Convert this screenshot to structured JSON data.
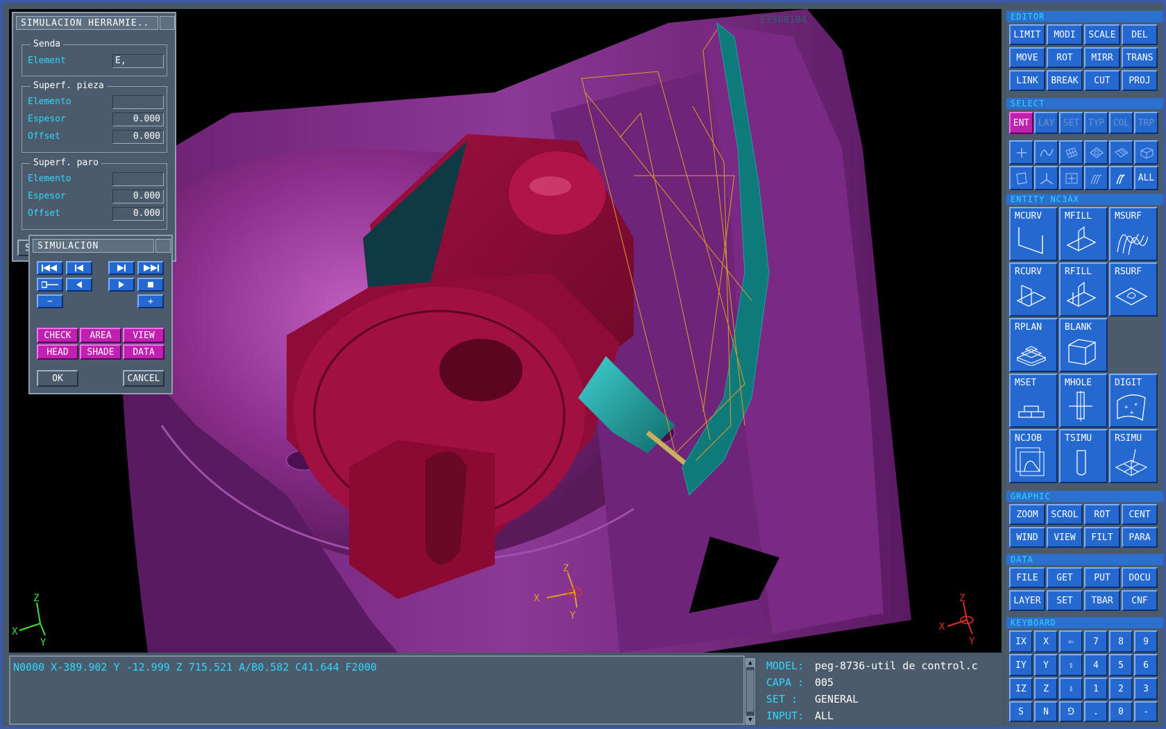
{
  "viewport": {
    "top_label": "E7360104",
    "axis_left": {
      "x": "X",
      "y": "Y",
      "z": "Z"
    },
    "axis_center": {
      "x": "X",
      "y": "Y",
      "z": "Z"
    },
    "axis_right": {
      "x": "X",
      "y": "Y",
      "z": "Z"
    }
  },
  "dialog_tool": {
    "title": "SIMULACION HERRAMIE..",
    "group_senda": {
      "title": "Senda",
      "element_label": "Element",
      "element_value": "E,"
    },
    "group_pieza": {
      "title": "Superf. pieza",
      "elemento_label": "Elemento",
      "elemento_value": "",
      "espesor_label": "Espesor",
      "espesor_value": "0.000",
      "offset_label": "Offset",
      "offset_value": "0.000"
    },
    "group_paro": {
      "title": "Superf. paro",
      "elemento_label": "Elemento",
      "elemento_value": "",
      "espesor_label": "Espesor",
      "espesor_value": "0.000",
      "offset_label": "Offset",
      "offset_value": "0.000"
    },
    "peek_label": "S"
  },
  "dialog_sim": {
    "title": "SIMULACION",
    "minus": "−",
    "plus": "+",
    "check": "CHECK",
    "area": "AREA",
    "view": "VIEW",
    "head": "HEAD",
    "shade": "SHADE",
    "data": "DATA",
    "ok": "OK",
    "cancel": "CANCEL"
  },
  "console": {
    "line": "N0000 X-389.902 Y -12.999 Z 715.521 A/B0.582 C41.644 F2000"
  },
  "info": {
    "model_key": "MODEL:",
    "model_val": "peg-8736-util de control.c",
    "capa_key": "CAPA :",
    "capa_val": "005",
    "set_key": "SET  :",
    "set_val": "GENERAL",
    "input_key": "INPUT:",
    "input_val": "ALL"
  },
  "panel": {
    "editor": {
      "title": "EDITOR",
      "buttons": [
        "LIMIT",
        "MODI",
        "SCALE",
        "DEL",
        "MOVE",
        "ROT",
        "MIRR",
        "TRANS",
        "LINK",
        "BREAK",
        "CUT",
        "PROJ"
      ]
    },
    "select": {
      "title": "SELECT",
      "buttons": [
        "ENT",
        "LAY",
        "SET",
        "TYP",
        "COL",
        "TRP"
      ],
      "all": "ALL"
    },
    "entity": {
      "title": "ENTITY  NC3AX",
      "buttons": [
        "MCURV",
        "MFILL",
        "MSURF",
        "RCURV",
        "RFILL",
        "RSURF",
        "RPLAN",
        "BLANK",
        "MSET",
        "MHOLE",
        "DIGIT",
        "NCJOB",
        "TSIMU",
        "RSIMU"
      ]
    },
    "graphic": {
      "title": "GRAPHIC",
      "buttons": [
        "ZOOM",
        "SCROL",
        "ROT",
        "CENT",
        "WIND",
        "VIEW",
        "FILT",
        "PARA"
      ]
    },
    "data": {
      "title": "DATA",
      "buttons": [
        "FILE",
        "GET",
        "PUT",
        "DOCU",
        "LAYER",
        "SET",
        "TBAR",
        "CNF"
      ]
    },
    "keyboard": {
      "title": "KEYBOARD",
      "keys": [
        "IX",
        "X",
        "⇦",
        "7",
        "8",
        "9",
        "IY",
        "Y",
        "⇧",
        "4",
        "5",
        "6",
        "IZ",
        "Z",
        "⇩",
        "1",
        "2",
        "3",
        "S",
        "N",
        "⅁",
        ".",
        "0",
        "-"
      ]
    }
  }
}
